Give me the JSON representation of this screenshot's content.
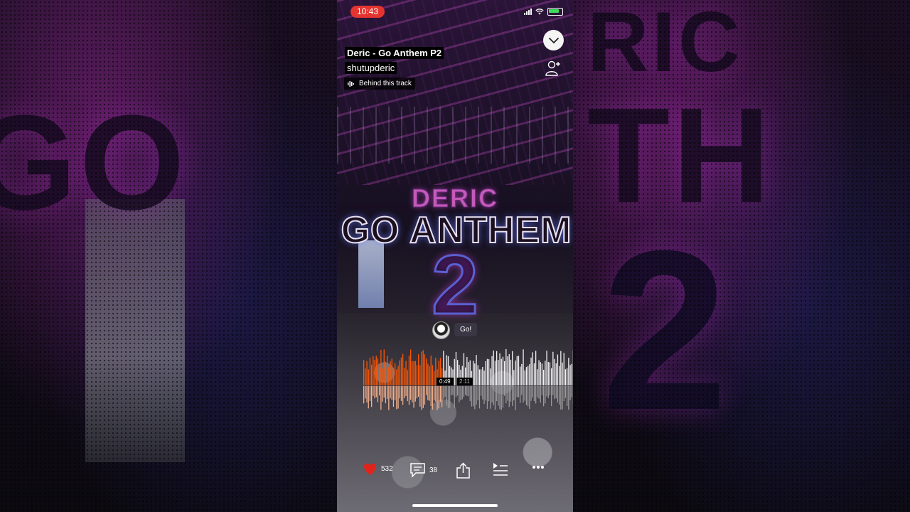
{
  "status_bar": {
    "time": "10:43"
  },
  "track": {
    "title": "Deric - Go Anthem P2",
    "artist": "shutupderic",
    "behind_label": "Behind this track"
  },
  "artwork": {
    "line1": "DERIC",
    "line2": "GO ANTHEM",
    "line3": "2"
  },
  "comment": {
    "text": "Go!"
  },
  "playback": {
    "position": "0:49",
    "duration": "2:11",
    "progress": 0.374
  },
  "actions": {
    "likes": "532",
    "comments": "38"
  },
  "colors": {
    "accent": "#ff5500",
    "like": "#e0241c",
    "time_pill": "#e5342f"
  }
}
